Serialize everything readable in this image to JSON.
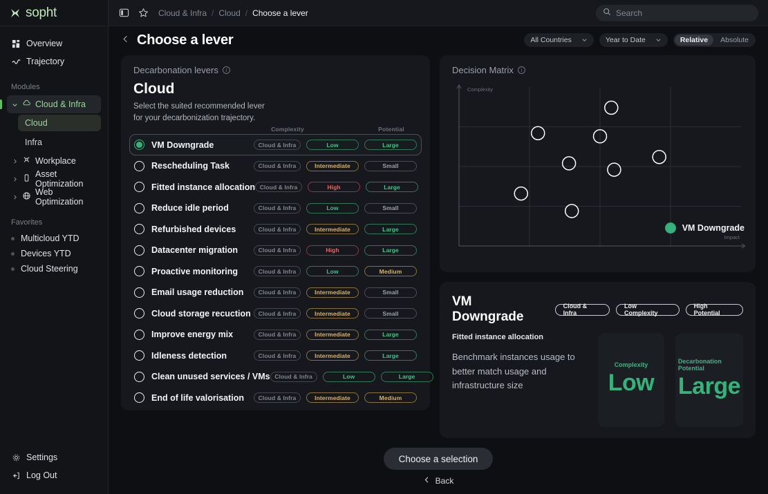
{
  "brand": {
    "name": "sopht"
  },
  "sidebar": {
    "nav": [
      {
        "label": "Overview",
        "icon": "grid-icon"
      },
      {
        "label": "Trajectory",
        "icon": "wave-icon"
      }
    ],
    "modules_label": "Modules",
    "modules": [
      {
        "label": "Cloud & Infra",
        "icon": "cloud-icon",
        "active": true,
        "expanded": true,
        "children": [
          {
            "label": "Cloud",
            "active": true
          },
          {
            "label": "Infra",
            "active": false
          }
        ]
      },
      {
        "label": "Workplace",
        "icon": "workplace-icon",
        "active": false
      },
      {
        "label": "Asset Optimization",
        "icon": "device-icon",
        "active": false
      },
      {
        "label": "Web Optimization",
        "icon": "globe-icon",
        "active": false
      }
    ],
    "favorites_label": "Favorites",
    "favorites": [
      {
        "label": "Multicloud YTD"
      },
      {
        "label": "Devices YTD"
      },
      {
        "label": "Cloud Steering"
      }
    ],
    "bottom": [
      {
        "label": "Settings",
        "icon": "gear-icon"
      },
      {
        "label": "Log Out",
        "icon": "logout-icon"
      }
    ]
  },
  "topbar": {
    "panel_toggle": "panel-toggle-icon",
    "favorite": "star-icon",
    "breadcrumbs": [
      {
        "label": "Cloud & Infra",
        "current": false
      },
      {
        "label": "Cloud",
        "current": false
      },
      {
        "label": "Choose a lever",
        "current": true
      }
    ],
    "separator": "/",
    "search": {
      "placeholder": "Search",
      "value": ""
    }
  },
  "pagehead": {
    "title": "Choose a lever",
    "back_icon": "chevron-left-icon",
    "country_filter": "All Countries",
    "period_filter": "Year to Date",
    "mode_relative": "Relative",
    "mode_absolute": "Absolute",
    "mode_selected": "Relative"
  },
  "levers_panel": {
    "card_title": "Decarbonation levers",
    "heading": "Cloud",
    "subtitle": "Select the suited recommended lever for your decarbonization trajectory.",
    "col_complexity": "Complexity",
    "col_potential": "Potential",
    "items": [
      {
        "name": "VM Downgrade",
        "category": "Cloud & Infra",
        "complexity": "Low",
        "potential": "Large",
        "selected": true
      },
      {
        "name": "Rescheduling Task",
        "category": "Cloud & Infra",
        "complexity": "Intermediate",
        "potential": "Small",
        "selected": false
      },
      {
        "name": "Fitted instance allocation",
        "category": "Cloud & Infra",
        "complexity": "High",
        "potential": "Large",
        "selected": false
      },
      {
        "name": "Reduce idle period",
        "category": "Cloud & Infra",
        "complexity": "Low",
        "potential": "Small",
        "selected": false
      },
      {
        "name": "Refurbished devices",
        "category": "Cloud & Infra",
        "complexity": "Intermediate",
        "potential": "Large",
        "selected": false
      },
      {
        "name": "Datacenter migration",
        "category": "Cloud & Infra",
        "complexity": "High",
        "potential": "Large",
        "selected": false
      },
      {
        "name": "Proactive monitoring",
        "category": "Cloud & Infra",
        "complexity": "Low",
        "potential": "Medium",
        "selected": false
      },
      {
        "name": "Email usage reduction",
        "category": "Cloud & Infra",
        "complexity": "Intermediate",
        "potential": "Small",
        "selected": false
      },
      {
        "name": "Cloud storage recuction",
        "category": "Cloud & Infra",
        "complexity": "Intermediate",
        "potential": "Small",
        "selected": false
      },
      {
        "name": "Improve energy mix",
        "category": "Cloud & Infra",
        "complexity": "Intermediate",
        "potential": "Large",
        "selected": false
      },
      {
        "name": "Idleness detection",
        "category": "Cloud & Infra",
        "complexity": "Intermediate",
        "potential": "Large",
        "selected": false
      },
      {
        "name": "Clean unused services / VMs",
        "category": "Cloud & Infra",
        "complexity": "Low",
        "potential": "Large",
        "selected": false
      },
      {
        "name": "End of life valorisation",
        "category": "Cloud & Infra",
        "complexity": "Intermediate",
        "potential": "Medium",
        "selected": false
      }
    ]
  },
  "matrix_panel": {
    "card_title": "Decision Matrix",
    "legend_label": "VM Downgrade"
  },
  "chart_data": {
    "type": "scatter",
    "title": "Decision Matrix",
    "xlabel": "Impact",
    "ylabel": "Complexity",
    "xlim": [
      0,
      100
    ],
    "ylim": [
      0,
      100
    ],
    "grid": true,
    "x_gridlines": [
      25,
      50,
      75
    ],
    "y_gridlines": [
      25,
      50,
      75
    ],
    "legend": [
      {
        "name": "VM Downgrade",
        "color": "#34b37a",
        "position": "bottom-right"
      }
    ],
    "points": [
      {
        "x": 54,
        "y": 87,
        "color": "#ffffff",
        "filled": false
      },
      {
        "x": 28,
        "y": 71,
        "color": "#ffffff",
        "filled": false
      },
      {
        "x": 50,
        "y": 69,
        "color": "#ffffff",
        "filled": false
      },
      {
        "x": 71,
        "y": 56,
        "color": "#ffffff",
        "filled": false
      },
      {
        "x": 39,
        "y": 52,
        "color": "#ffffff",
        "filled": false
      },
      {
        "x": 55,
        "y": 48,
        "color": "#ffffff",
        "filled": false
      },
      {
        "x": 22,
        "y": 33,
        "color": "#ffffff",
        "filled": false
      },
      {
        "x": 40,
        "y": 22,
        "color": "#ffffff",
        "filled": false
      }
    ]
  },
  "detail_panel": {
    "title": "VM Downgrade",
    "badges": [
      "Cloud & Infra",
      "Low Complexity",
      "High Potential"
    ],
    "subtitle": "Fitted instance allocation",
    "description": "Benchmark instances usage to better match usage and infrastructure size",
    "stats": [
      {
        "label": "Complexity",
        "value": "Low"
      },
      {
        "label": "Decarbonation Potential",
        "value": "Large"
      }
    ]
  },
  "footer": {
    "cta_label": "Choose a selection",
    "back_label": "Back",
    "back_icon": "chevron-left-icon"
  }
}
